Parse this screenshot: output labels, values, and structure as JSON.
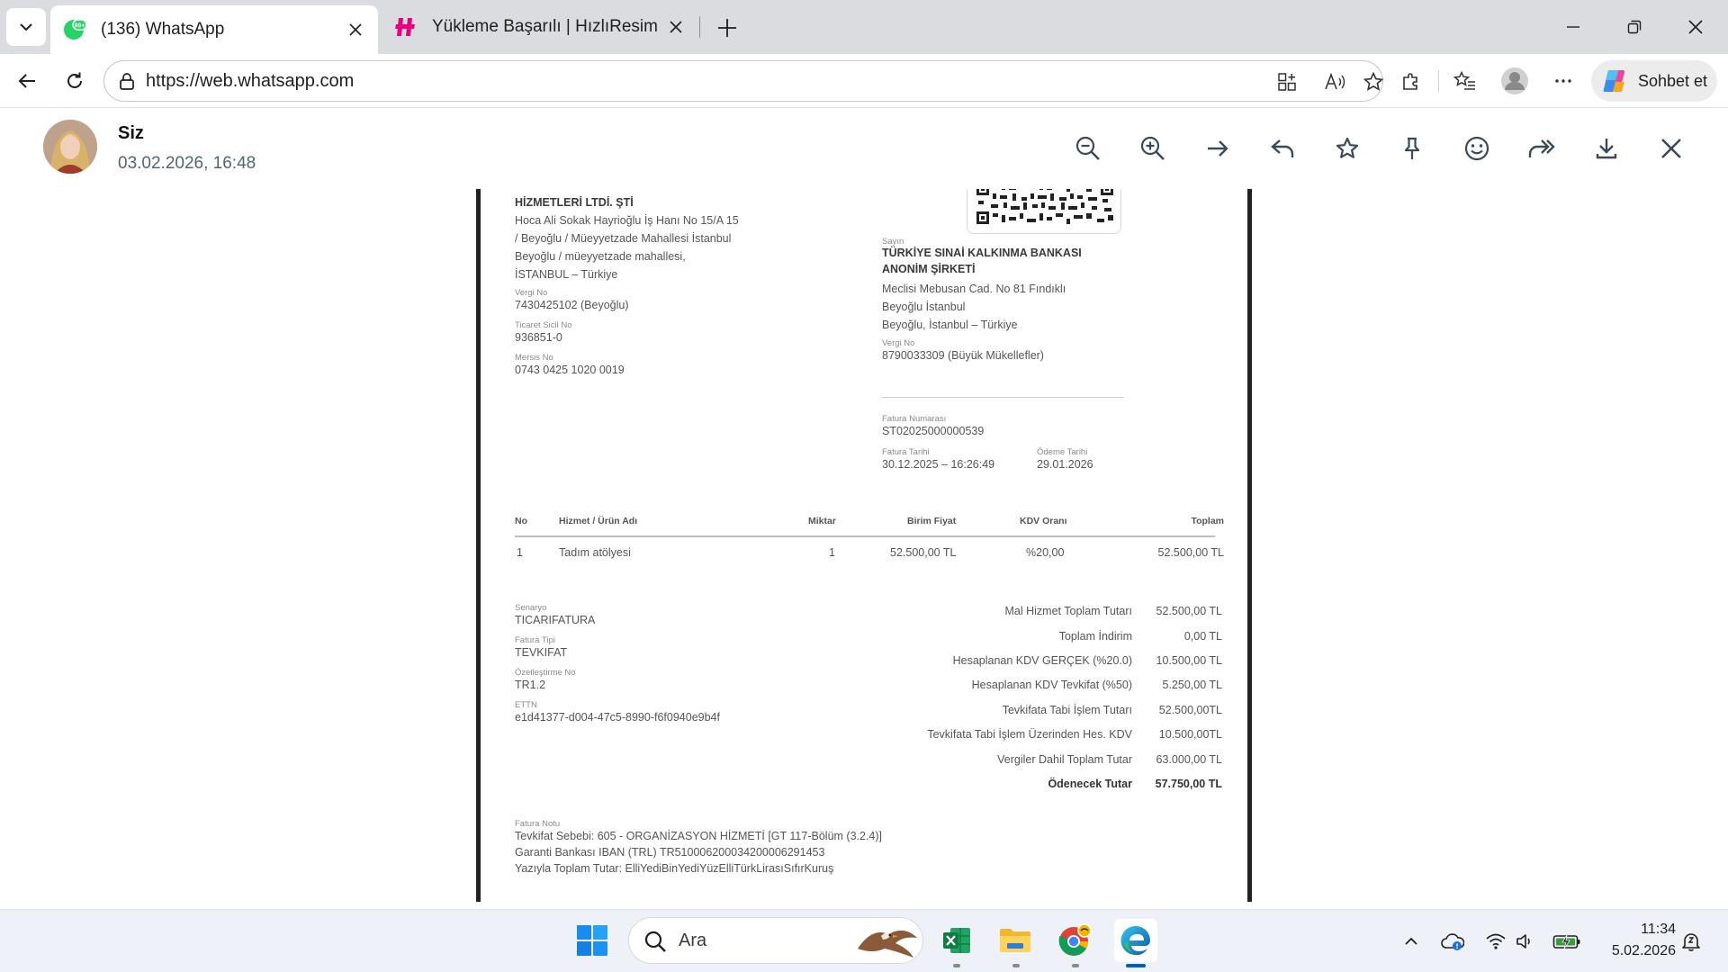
{
  "browser": {
    "tabs": [
      {
        "title": "(136) WhatsApp",
        "badge": "99+",
        "active": true
      },
      {
        "title": "Yükleme Başarılı | HızlıResim",
        "active": false
      }
    ],
    "url": "https://web.whatsapp.com",
    "copilot_label": "Sohbet et"
  },
  "viewer": {
    "sender": "Siz",
    "timestamp": "03.02.2026, 16:48",
    "actions": [
      "zoom-out",
      "zoom-in",
      "forward",
      "reply",
      "star",
      "pin",
      "react",
      "forward-all",
      "download",
      "close"
    ]
  },
  "invoice": {
    "seller_name": "HİZMETLERİ LTDİ. ŞTİ",
    "seller_address": [
      "Hoca Ali Sokak Hayrioğlu İş Hanı No 15/A 15",
      "/ Beyoğlu / Müeyyetzade Mahallesi İstanbul",
      "Beyoğlu / müeyyetzade mahallesi,",
      "İSTANBUL – Türkiye"
    ],
    "seller_tax_label": "Vergi No",
    "seller_tax_no": "7430425102 (Beyoğlu)",
    "trade_reg_label": "Ticaret Sicil No",
    "trade_reg_no": "936851-0",
    "mersis_label": "Mersis No",
    "mersis_no": "0743 0425 1020 0019",
    "buyer_label": "Sayın",
    "buyer_name_1": "TÜRKİYE SINAİ KALKINMA BANKASI",
    "buyer_name_2": "ANONİM ŞİRKETİ",
    "buyer_address": [
      "Meclisi Mebusan Cad. No 81 Fındıklı",
      "Beyoğlu İstanbul",
      "Beyoğlu, İstanbul – Türkiye"
    ],
    "buyer_tax_label": "Vergi No",
    "buyer_tax_no": "8790033309 (Büyük Mükellefler)",
    "invoice_no_label": "Fatura Numarası",
    "invoice_no": "ST02025000000539",
    "invoice_date_label": "Fatura Tarihi",
    "invoice_date": "30.12.2025 – 16:26:49",
    "due_date_label": "Ödeme Tarihi",
    "due_date": "29.01.2026",
    "table_headers": [
      "No",
      "Hizmet / Ürün Adı",
      "Miktar",
      "Birim Fiyat",
      "KDV Oranı",
      "Toplam"
    ],
    "rows": [
      {
        "no": "1",
        "name": "Tadım atölyesi",
        "qty": "1",
        "unit_price": "52.500,00 TL",
        "vat": "%20,00",
        "total": "52.500,00 TL"
      }
    ],
    "meta": [
      {
        "label": "Senaryo",
        "value": "TICARIFATURA"
      },
      {
        "label": "Fatura Tipi",
        "value": "TEVKIFAT"
      },
      {
        "label": "Özelleştirme No",
        "value": "TR1.2"
      },
      {
        "label": "ETTN",
        "value": "e1d41377-d004-47c5-8990-f6f0940e9b4f"
      }
    ],
    "totals": [
      {
        "label": "Mal Hizmet Toplam Tutarı",
        "value": "52.500,00 TL"
      },
      {
        "label": "Toplam İndirim",
        "value": "0,00 TL"
      },
      {
        "label": "Hesaplanan KDV GERÇEK (%20.0)",
        "value": "10.500,00 TL"
      },
      {
        "label": "Hesaplanan KDV Tevkifat (%50)",
        "value": "5.250,00 TL"
      },
      {
        "label": "Tevkifata Tabi İşlem Tutarı",
        "value": "52.500,00TL"
      },
      {
        "label": "Tevkifata Tabi İşlem Üzerinden Hes. KDV",
        "value": "10.500,00TL"
      },
      {
        "label": "Vergiler Dahil Toplam Tutar",
        "value": "63.000,00 TL"
      },
      {
        "label": "Ödenecek Tutar",
        "value": "57.750,00 TL"
      }
    ],
    "note_label": "Fatura Notu",
    "notes": [
      "Tevkifat Sebebi: 605 - ORGANİZASYON HİZMETİ [GT 117-Bölüm (3.2.4)]",
      "Garanti Bankası IBAN (TRL) TR510006200034200006291453",
      "Yazıyla Toplam Tutar: ElliYediBinYediYüzElliTürkLirasıSıfırKuruş"
    ]
  },
  "taskbar": {
    "search_placeholder": "Ara",
    "time": "11:34",
    "date": "5.02.2026"
  },
  "colors": {
    "whatsapp_green": "#25d366",
    "accent_blue": "#005fb8",
    "hizliresim_magenta": "#e6007e"
  }
}
